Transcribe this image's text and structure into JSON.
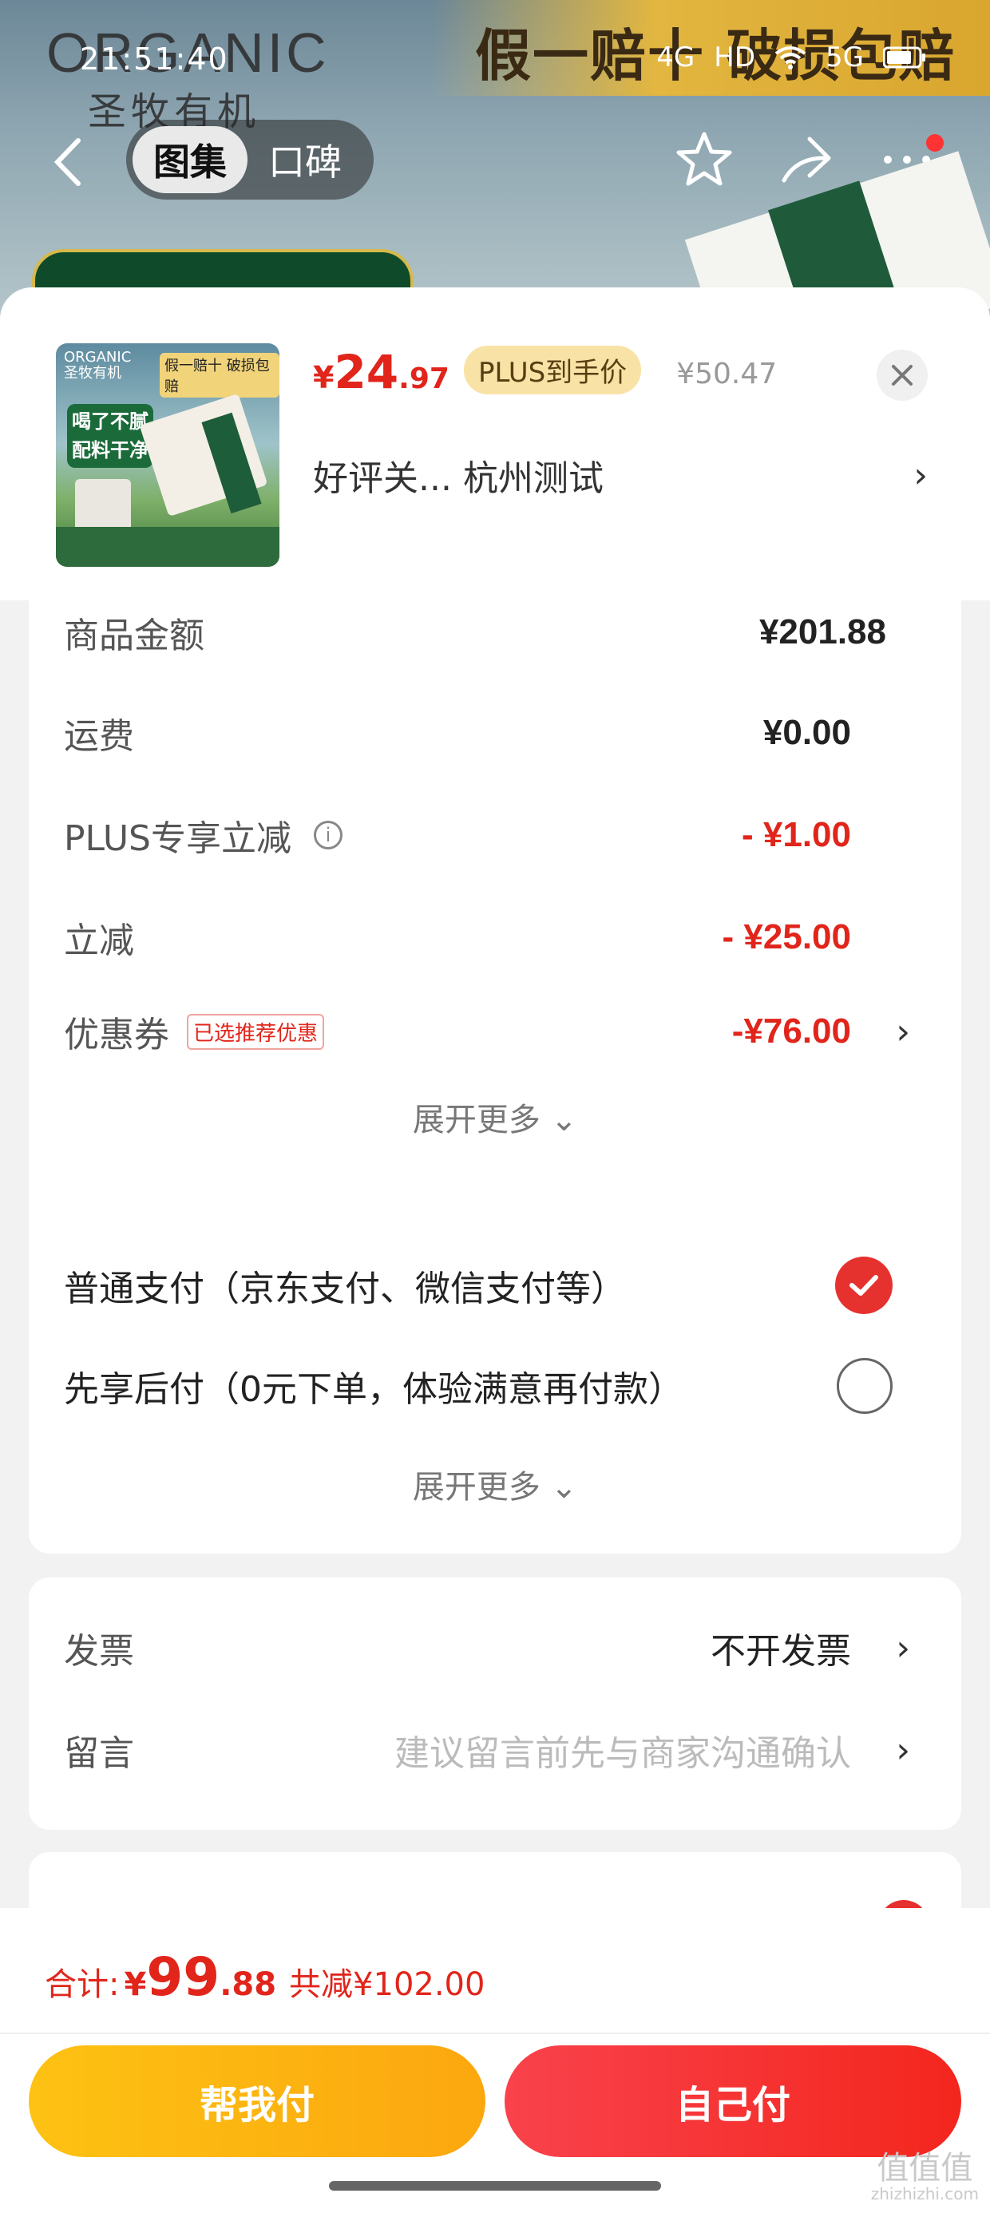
{
  "background": {
    "brand": "ORGANIC",
    "brand_cn": "圣牧有机",
    "slogan": "假一赔十 破损包赔",
    "status_time": "21:51:40",
    "status_right": [
      "4G",
      "HD",
      "5G"
    ],
    "tabs": [
      "图集",
      "口碑"
    ]
  },
  "product": {
    "thumb_brand": "ORGANIC\n圣牧有机",
    "thumb_slogan": "假一赔十 破损包赔",
    "thumb_headline": "喝了不腻 配料干净",
    "price_symbol": "¥",
    "price_int": "24",
    "price_dec": ".97",
    "plus_tag": "PLUS到手价",
    "original_price": "¥50.47",
    "spec": "好评关...  杭州测试"
  },
  "amounts": {
    "goods_label": "商品金额",
    "goods_value": "¥201.88",
    "shipping_label": "运费",
    "shipping_value": "¥0.00",
    "plus_label": "PLUS专享立减",
    "plus_value": "- ¥1.00",
    "instant_label": "立减",
    "instant_value": "- ¥25.00",
    "coupon_label": "优惠券",
    "coupon_tag": "已选推荐优惠",
    "coupon_value": "-¥76.00",
    "expand": "展开更多"
  },
  "payment": {
    "option1": "普通支付（京东支付、微信支付等）",
    "option2": "先享后付（0元下单，体验满意再付款）",
    "expand": "展开更多"
  },
  "extra": {
    "invoice_label": "发票",
    "invoice_value": "不开发票",
    "message_label": "留言",
    "message_placeholder": "建议留言前先与商家沟通确认"
  },
  "footer": {
    "total_label": "合计:",
    "total_symbol": "¥",
    "total_int": "99",
    "total_dec": ".88",
    "saved": "共减¥102.00",
    "help_pay": "帮我付",
    "self_pay": "自己付",
    "watermark": "值值值",
    "watermark_url": "zhizhizhi.com"
  },
  "colors": {
    "accent_red": "#e1251b",
    "help_yellow": "#fdc213",
    "plus_gold": "#f8e2a6"
  }
}
